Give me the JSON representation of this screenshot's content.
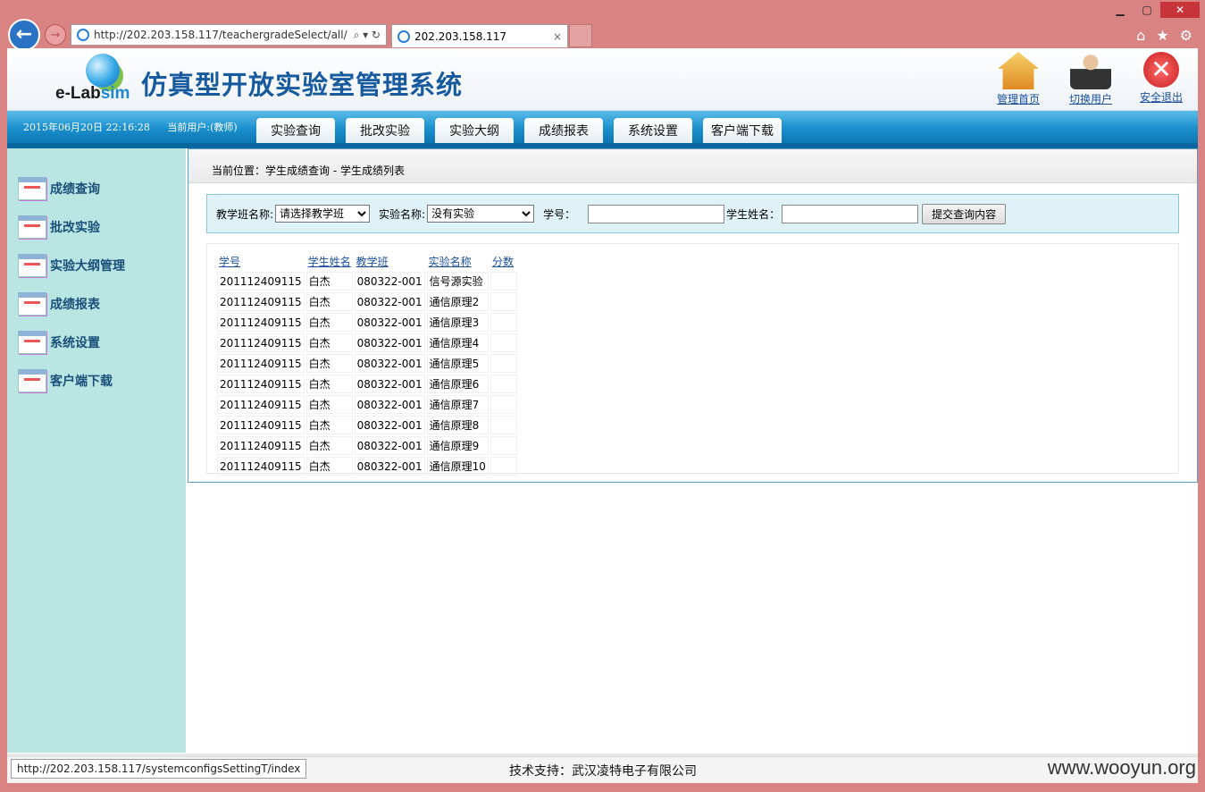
{
  "browser": {
    "url": "http://202.203.158.117/teachergradeSelect/all/",
    "tab_title": "202.203.158.117",
    "addr_icons": "⌕ ▾ ↻",
    "tab_close": "×",
    "back_glyph": "←",
    "forward_glyph": "→",
    "home_glyph": "⌂",
    "star_glyph": "★",
    "gear_glyph": "⚙",
    "min_glyph": "▁",
    "max_glyph": "▢",
    "close_glyph": "✕",
    "status_url": "http://202.203.158.117/systemconfigsSettingT/index"
  },
  "header": {
    "logo_prefix": "e-Lab",
    "logo_suffix": "sim",
    "system_title": "仿真型开放实验室管理系统",
    "top_links": {
      "home": "管理首页",
      "switch": "切换用户",
      "logout": "安全退出",
      "logout_glyph": "✕"
    }
  },
  "navbar": {
    "datetime": "2015年06月20日 22:16:28",
    "current_user": "当前用户:(教师)",
    "tabs": [
      "实验查询",
      "批改实验",
      "实验大纲",
      "成绩报表",
      "系统设置",
      "客户端下载"
    ]
  },
  "sidebar": {
    "items": [
      "成绩查询",
      "批改实验",
      "实验大纲管理",
      "成绩报表",
      "系统设置",
      "客户端下载"
    ]
  },
  "breadcrumb": "当前位置：学生成绩查询 - 学生成绩列表",
  "filter": {
    "class_label": "教学班名称:",
    "class_value": "请选择教学班",
    "exp_label": "实验名称:",
    "exp_value": "没有实验",
    "id_label": "学号：",
    "name_label": "学生姓名：",
    "submit": "提交查询内容"
  },
  "table": {
    "headers": [
      "学号",
      "学生姓名",
      "教学班",
      "实验名称",
      "分数"
    ],
    "rows": [
      [
        "201112409115",
        "白杰",
        "080322-001",
        "信号源实验",
        ""
      ],
      [
        "201112409115",
        "白杰",
        "080322-001",
        "通信原理2",
        ""
      ],
      [
        "201112409115",
        "白杰",
        "080322-001",
        "通信原理3",
        ""
      ],
      [
        "201112409115",
        "白杰",
        "080322-001",
        "通信原理4",
        ""
      ],
      [
        "201112409115",
        "白杰",
        "080322-001",
        "通信原理5",
        ""
      ],
      [
        "201112409115",
        "白杰",
        "080322-001",
        "通信原理6",
        ""
      ],
      [
        "201112409115",
        "白杰",
        "080322-001",
        "通信原理7",
        ""
      ],
      [
        "201112409115",
        "白杰",
        "080322-001",
        "通信原理8",
        ""
      ],
      [
        "201112409115",
        "白杰",
        "080322-001",
        "通信原理9",
        ""
      ],
      [
        "201112409115",
        "白杰",
        "080322-001",
        "通信原理10",
        ""
      ]
    ]
  },
  "footer": {
    "support": "技术支持：武汉凌特电子有限公司",
    "watermark": "www.wooyun.org"
  }
}
